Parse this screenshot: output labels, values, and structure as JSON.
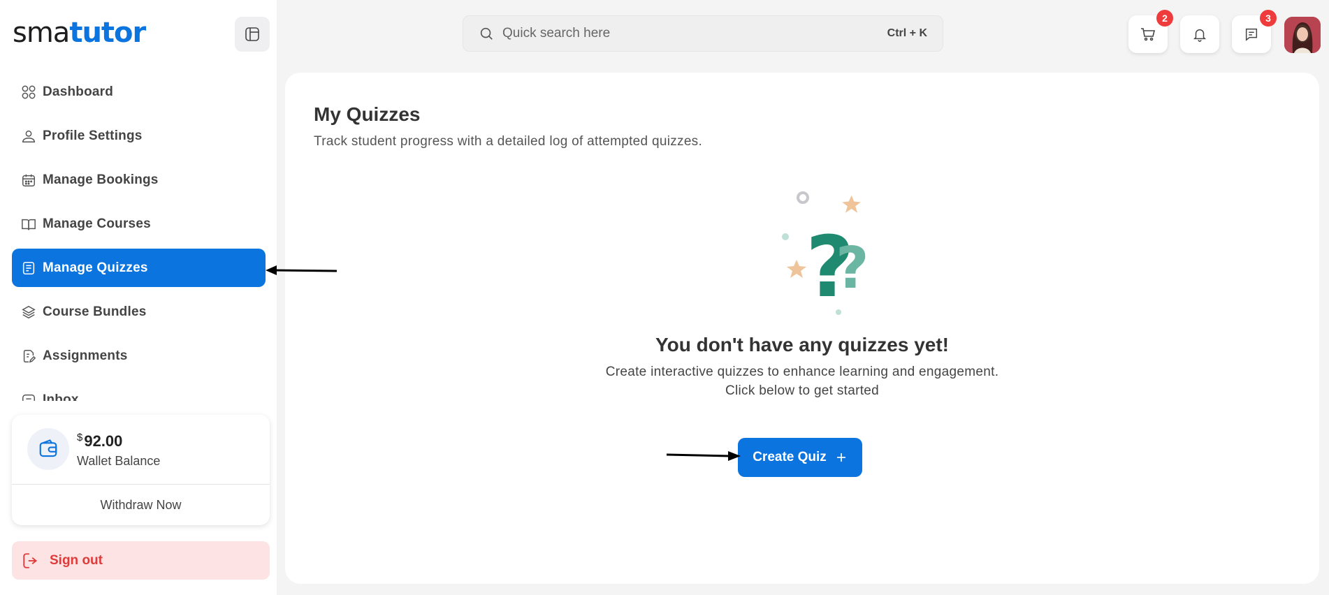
{
  "brand": {
    "part1": "sma",
    "part2": "tutor"
  },
  "search": {
    "placeholder": "Quick search here",
    "shortcut": "Ctrl + K"
  },
  "header": {
    "cart_badge": "2",
    "messages_badge": "3"
  },
  "sidebar": {
    "items": [
      {
        "label": "Dashboard",
        "icon": "grid-icon"
      },
      {
        "label": "Profile Settings",
        "icon": "user-icon"
      },
      {
        "label": "Manage Bookings",
        "icon": "calendar-icon"
      },
      {
        "label": "Manage Courses",
        "icon": "book-icon"
      },
      {
        "label": "Manage Quizzes",
        "icon": "quiz-icon",
        "active": true
      },
      {
        "label": "Course Bundles",
        "icon": "layers-icon"
      },
      {
        "label": "Assignments",
        "icon": "assignment-icon"
      },
      {
        "label": "Inbox",
        "icon": "inbox-icon"
      }
    ]
  },
  "wallet": {
    "currency": "$",
    "amount": "92.00",
    "label": "Wallet Balance",
    "withdraw_label": "Withdraw Now"
  },
  "signout_label": "Sign out",
  "main": {
    "title": "My Quizzes",
    "subtitle": "Track student progress with a detailed log of attempted quizzes.",
    "empty_title": "You don't have any quizzes yet!",
    "empty_line1": "Create interactive quizzes to enhance learning and engagement.",
    "empty_line2": "Click below to get started",
    "create_label": "Create Quiz"
  },
  "colors": {
    "primary": "#0b74de",
    "danger": "#e03b3b",
    "illustration_green": "#1f8a70",
    "illustration_light_green": "#6bb5a3",
    "illustration_star": "#f0c49a"
  }
}
